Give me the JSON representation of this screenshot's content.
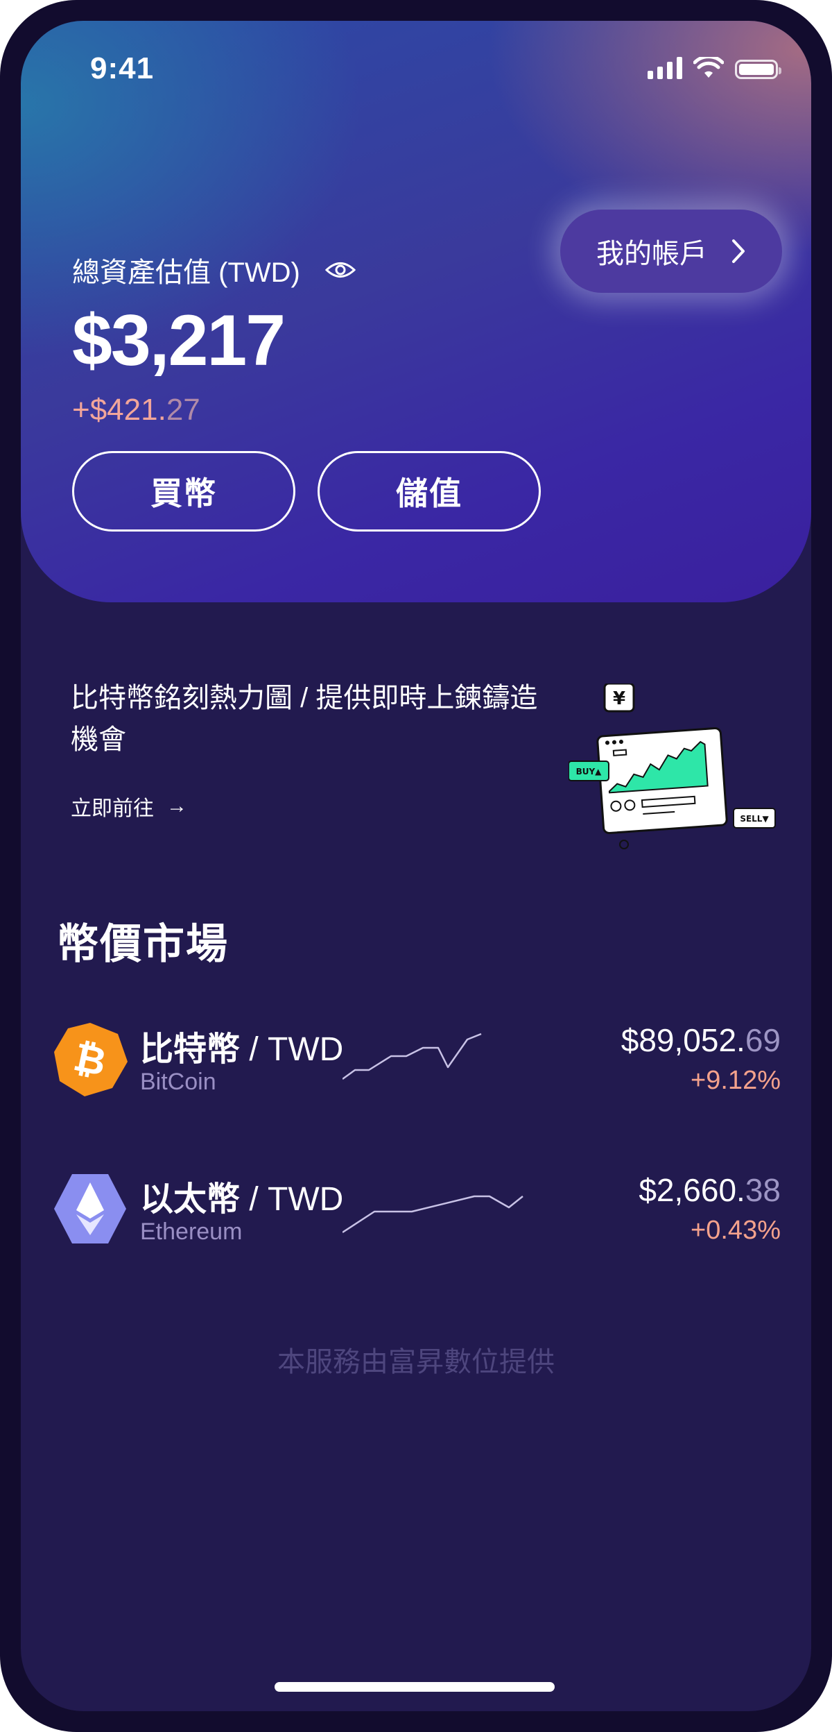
{
  "status_bar": {
    "time": "9:41"
  },
  "hero": {
    "asset_label": "總資產估值 (TWD)",
    "balance": "$3,217",
    "change_main": "+$421.",
    "change_decimal": "27",
    "account_button": "我的帳戶",
    "buy_button": "買幣",
    "topup_button": "儲值"
  },
  "promo": {
    "text": "比特幣銘刻熱力圖 / 提供即時上鍊鑄造機會",
    "link": "立即前往",
    "arrow": "→",
    "illustration": {
      "currency_symbol": "¥",
      "buy_tag": "BUY▲",
      "sell_tag": "SELL▼",
      "accent_color": "#2ee6a8"
    }
  },
  "market": {
    "title": "幣價市場",
    "coins": [
      {
        "name": "比特幣",
        "pair": " / TWD",
        "subtitle": "BitCoin",
        "price_main": "$89,052.",
        "price_decimal": "69",
        "change": "+9.12%",
        "icon": "bitcoin-icon",
        "icon_color": "#f7931a"
      },
      {
        "name": "以太幣",
        "pair": " / TWD",
        "subtitle": "Ethereum",
        "price_main": "$2,660.",
        "price_decimal": "38",
        "change": "+0.43%",
        "icon": "ethereum-icon",
        "icon_color": "#8a8ef0"
      }
    ]
  },
  "footer": {
    "note": "本服務由富昇數位提供"
  },
  "colors": {
    "background": "#221a4f",
    "positive_change": "#f4a28c",
    "account_button": "#4d3aa0"
  }
}
